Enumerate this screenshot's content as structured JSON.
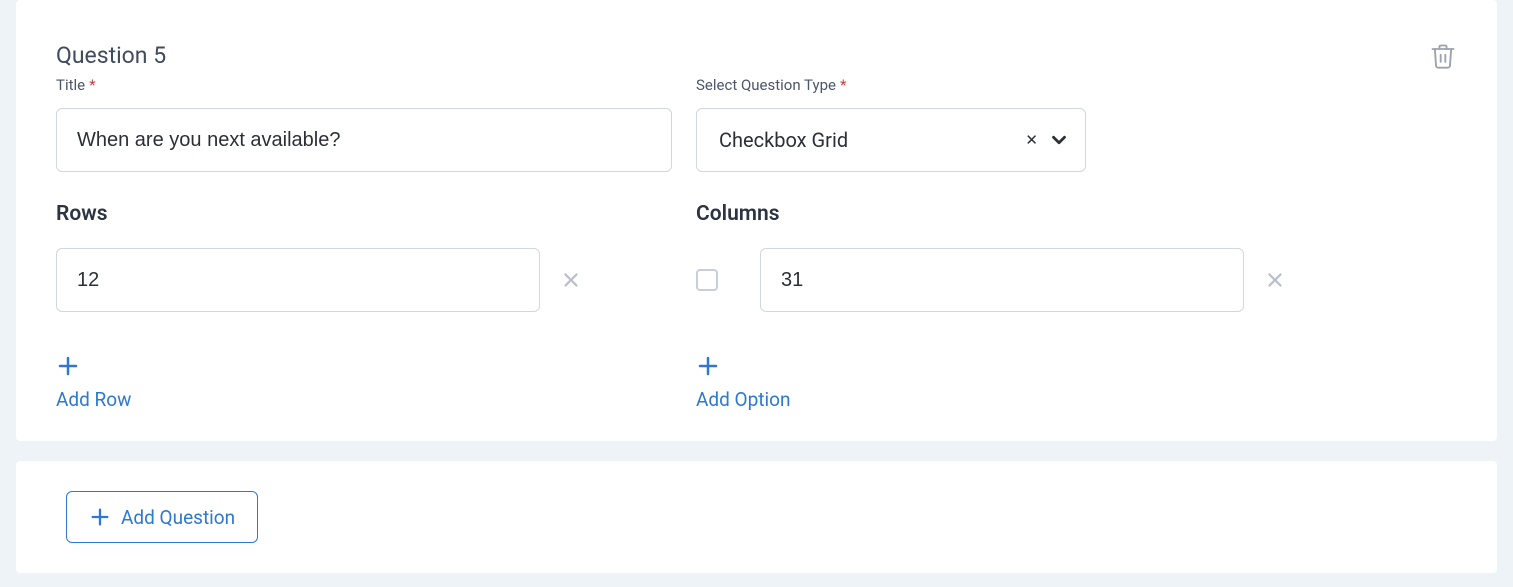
{
  "question": {
    "heading": "Question 5",
    "title_label": "Title",
    "title_value": "When are you next available?",
    "type_label": "Select Question Type",
    "type_value": "Checkbox Grid",
    "required_mark": "*"
  },
  "rows": {
    "heading": "Rows",
    "items": [
      {
        "value": "12"
      }
    ],
    "add_label": "Add Row"
  },
  "columns": {
    "heading": "Columns",
    "items": [
      {
        "value": "31"
      }
    ],
    "add_label": "Add Option"
  },
  "footer": {
    "add_question": "Add Question"
  }
}
